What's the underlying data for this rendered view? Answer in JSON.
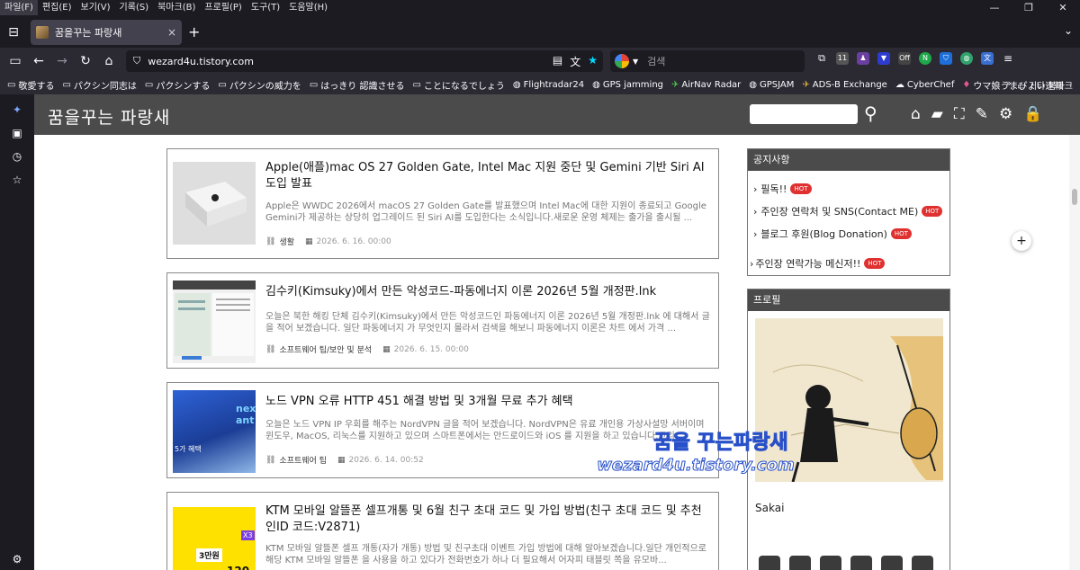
{
  "menubar": {
    "items": [
      "파일(F)",
      "편집(E)",
      "보기(V)",
      "기록(S)",
      "북마크(B)",
      "프로필(P)",
      "도구(T)",
      "도움말(H)"
    ]
  },
  "tab": {
    "title": "꿈을꾸는 파랑새",
    "close": "×"
  },
  "toolbar": {
    "new_tab": "+",
    "tab_list": "⌄"
  },
  "urlbar": {
    "url": "wezard4u.tistory.com"
  },
  "searchbar": {
    "placeholder": "검색"
  },
  "extensions": {
    "badge_count": "11",
    "off_label": "Off"
  },
  "bookmarks": {
    "items": [
      "敬愛する",
      "パクシン同志は",
      "パクシンする",
      "パクシンの威力を",
      "はっきり 認識させる",
      "ことになるでしょう",
      "Flightradar24",
      "GPS jamming",
      "AirNav Radar",
      "GPSJAM",
      "ADS-B Exchange",
      "CyberChef",
      "ウマ娘うまぴょい速報"
    ],
    "more": "»",
    "other": "기타 북마크"
  },
  "site": {
    "title": "꿈을꾸는 파랑새",
    "search_placeholder": ""
  },
  "posts": [
    {
      "title": "Apple(애플)mac OS 27 Golden Gate, Intel Mac 지원 중단 및 Gemini 기반 Siri AI 도입 발표",
      "excerpt": "Apple은 WWDC 2026에서 macOS 27 Golden Gate를 발표했으며 Intel Mac에 대한 지원이 종료되고 Google Gemini가 제공하는 상당히 업그레이드 된 Siri AI를 도입한다는 소식입니다.새로운 운영 체제는 출가을 출시될 ...",
      "category": "생활",
      "date": "2026. 6. 16. 00:00"
    },
    {
      "title": "김수키(Kimsuky)에서 만든 악성코드-파동에너지 이론 2026년 5월 개정판.lnk",
      "excerpt": "오늘은 북한 해킹 단체 김수키(Kimsuky)에서 만든 악성코드인 파동에너지 이론 2026년 5월 개정판.lnk 에 대해서 글을 적어 보겠습니다. 일단 파동에너지 가 무엇인지 몰라서 검색을 해보니 파동에너지 이론은 차트 에서 가격 ...",
      "category": "소프트웨어 팁/보안 및 분석",
      "date": "2026. 6. 15. 00:00"
    },
    {
      "title": "노드 VPN 오류 HTTP 451 해결 방법 및 3개월 무료 추가 혜택",
      "excerpt": "오늘은 노드 VPN IP 우회를 해주는 NordVPN 글을 적어 보겠습니다. NordVPN은 유료 개인용 가상사설망 서버이며 윈도우, MacOS, 리눅스를 지원하고 있으며 스마트폰에서는 안드로이드와 iOS 를 지원을 하고 있습니다.그리...",
      "category": "소프트웨어 팁",
      "date": "2026. 6. 14. 00:52"
    },
    {
      "title": "KTM 모바일 알뜰폰 셀프개통 및 6월 친구 초대 코드 및 가입 방법(친구 초대 코드 및 추천인ID 코드:V2871)",
      "excerpt": "KTM 모바일 알뜰폰 셀프 개통(자가 개통) 방법 및 친구초대 이벤트 가입 방법에 대해 알아보겠습니다.일단 개인적으로 해당 KTM 모바일 알뜰폰 을 사용을 하고 있다가 전화번호가 하나 더 필요해서 어자피 태블릿 쪽을 유모바...",
      "category": "",
      "date": ""
    }
  ],
  "thumbs": {
    "post3_text": "nex",
    "post3_text2": "ant",
    "post3_text3": "5가 혜택",
    "post4_badge": "3만원",
    "post4_x": "X3",
    "post4_num": "120"
  },
  "notice": {
    "title": "공지사항",
    "items": [
      "필독!!",
      "주인장 연락처 및 SNS(Contact ME)",
      "블로그 후원(Blog Donation)",
      "주인장 연락가능 메신저!!"
    ],
    "hot": "HOT"
  },
  "profile": {
    "title": "프로필",
    "name": "Sakai",
    "watermark1": "꿈을 꾸는파랑새",
    "watermark2": "wezard4u.tistory.com"
  },
  "colors": {
    "header_bg": "#4b4b4b",
    "hot_badge": "#e03131",
    "browser_bg": "#1c1b22",
    "toolbar_bg": "#2b2a33"
  }
}
